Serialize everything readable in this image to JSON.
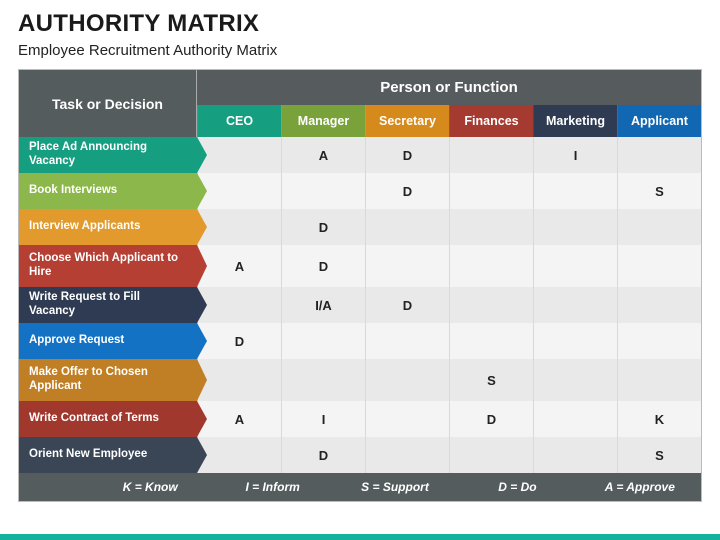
{
  "title": "AUTHORITY MATRIX",
  "subtitle": "Employee Recruitment Authority Matrix",
  "header": {
    "task": "Task or Decision",
    "group": "Person or Function"
  },
  "roles": [
    "CEO",
    "Manager",
    "Secretary",
    "Finances",
    "Marketing",
    "Applicant"
  ],
  "tasks": [
    {
      "label": "Place Ad Announcing Vacancy",
      "colorClass": "c-teal",
      "tall": false,
      "cells": [
        "",
        "A",
        "D",
        "",
        "I",
        ""
      ]
    },
    {
      "label": "Book Interviews",
      "colorClass": "c-green",
      "tall": false,
      "cells": [
        "",
        "",
        "D",
        "",
        "",
        "S"
      ]
    },
    {
      "label": "Interview Applicants",
      "colorClass": "c-orange",
      "tall": false,
      "cells": [
        "",
        "D",
        "",
        "",
        "",
        ""
      ]
    },
    {
      "label": "Choose Which Applicant to Hire",
      "colorClass": "c-red",
      "tall": true,
      "cells": [
        "A",
        "D",
        "",
        "",
        "",
        ""
      ]
    },
    {
      "label": "Write Request to Fill Vacancy",
      "colorClass": "c-navy",
      "tall": false,
      "cells": [
        "",
        "I/A",
        "D",
        "",
        "",
        ""
      ]
    },
    {
      "label": "Approve Request",
      "colorClass": "c-blue",
      "tall": false,
      "cells": [
        "D",
        "",
        "",
        "",
        "",
        ""
      ]
    },
    {
      "label": "Make Offer to Chosen Applicant",
      "colorClass": "c-dorange",
      "tall": true,
      "cells": [
        "",
        "",
        "",
        "S",
        "",
        ""
      ]
    },
    {
      "label": "Write  Contract of Terms",
      "colorClass": "c-dred",
      "tall": false,
      "cells": [
        "A",
        "I",
        "",
        "D",
        "",
        "K"
      ]
    },
    {
      "label": "Orient New Employee",
      "colorClass": "c-dark",
      "tall": false,
      "cells": [
        "",
        "D",
        "",
        "",
        "",
        "S"
      ]
    }
  ],
  "legend": [
    "K = Know",
    "I = Inform",
    "S = Support",
    "D = Do",
    "A = Approve"
  ]
}
